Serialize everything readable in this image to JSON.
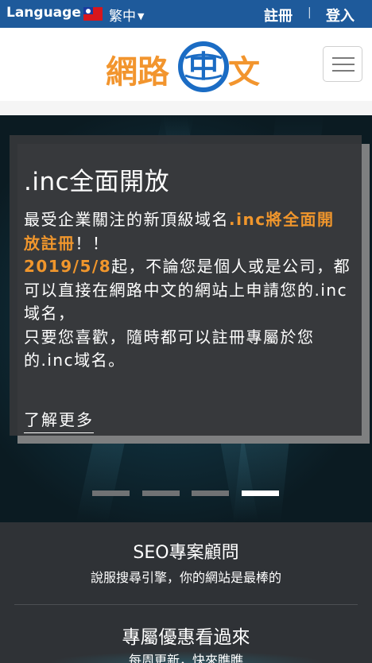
{
  "topbar": {
    "language_label": "Language",
    "language_selected": "繁中",
    "register": "註冊",
    "separator": "|",
    "login": "登入"
  },
  "header": {
    "logo_left": "網路",
    "logo_center": "中",
    "logo_right": "文"
  },
  "hero": {
    "title": ".inc全面開放",
    "line1_a": "最受企業關注的新頂級域名",
    "line1_b": ".inc將全面開放註冊",
    "line1_c": "！！",
    "date": "2019/5/8",
    "line2": "起，不論您是個人或是公司，都可以直接在網路中文的網站上申請您的.inc域名，",
    "line3": "只要您喜歡，隨時都可以註冊專屬於您的.inc域名。",
    "more": "了解更多",
    "slides_total": 4,
    "slide_active": 4
  },
  "info": {
    "item1_title": "SEO專案顧問",
    "item1_sub": "說服搜尋引擎，你的網站是最棒的",
    "item2_title": "專屬優惠看過來",
    "item2_sub": "每周更新，快來瞧瞧"
  },
  "colors": {
    "topbar": "#1e5a9b",
    "accent_orange": "#f0962c",
    "logo_blue": "#1b6cc4"
  }
}
